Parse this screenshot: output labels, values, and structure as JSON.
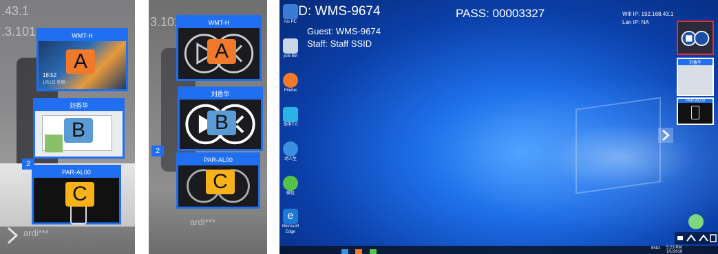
{
  "panel1": {
    "ghost_ip": [
      ".43.1",
      ".3.101"
    ],
    "cards": [
      {
        "title": "WMT-H",
        "badge": "A",
        "thumb_time": "18:52",
        "thumb_date": "1月1日 星期一"
      },
      {
        "title": "刘香华",
        "badge": "B"
      },
      {
        "title": "PAR-AL00",
        "badge": "C"
      }
    ],
    "group_number": "2",
    "bottom_ghost": "ardi***"
  },
  "panel2": {
    "ghost_ip": "3.101",
    "cards": [
      {
        "title": "WMT-H",
        "badge": "A"
      },
      {
        "title": "刘香华",
        "badge": "B"
      },
      {
        "title": "PAR-AL00",
        "badge": "C"
      }
    ],
    "group_number": "2",
    "bottom_ghost": "ardi***"
  },
  "panel3": {
    "id_label": "ID: WMS-9674",
    "pass_label": "PASS: 00003327",
    "guest_label": "Guest: WMS-9674",
    "staff_label": "Staff: Staff SSID",
    "wifi_ip": "Wifi IP: 192.168.43.1",
    "lan_ip": "Lan IP: NA",
    "desktop_icons": [
      {
        "label": "his PC",
        "color": "#3a7bd5"
      },
      {
        "label": "ycle Bin",
        "color": "#c9d6e8"
      },
      {
        "label": "Firefox",
        "color": "#f0792a"
      },
      {
        "label": "助手7.0",
        "color": "#2bb3e8"
      },
      {
        "label": "动人生",
        "color": "#3a8fe0"
      },
      {
        "label": "微信",
        "color": "#55c24a"
      },
      {
        "label": "Microsoft Edge",
        "color": "#1e78d7"
      }
    ],
    "sidebar_cards": [
      {
        "title": ""
      },
      {
        "title": "刘香华"
      },
      {
        "title": "PAR-AL00"
      }
    ],
    "clock_time": "5:23 PM",
    "clock_date": "1/1/2018",
    "tray_lang": "ENG"
  }
}
